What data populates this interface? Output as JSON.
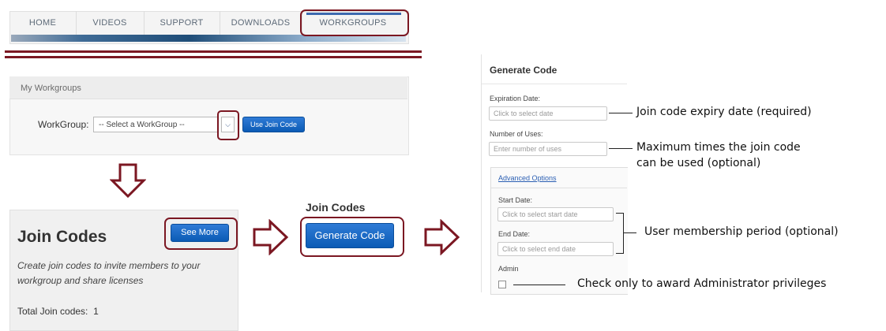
{
  "nav": {
    "items": [
      "HOME",
      "VIDEOS",
      "SUPPORT",
      "DOWNLOADS",
      "WORKGROUPS"
    ]
  },
  "workgroups": {
    "title": "My Workgroups",
    "label": "WorkGroup:",
    "select_value": "-- Select a WorkGroup --",
    "join_button": "Use Join Code"
  },
  "join_codes": {
    "title": "Join Codes",
    "see_more": "See More",
    "description": "Create join codes to invite members to your workgroup and share licenses",
    "total_label": "Total Join codes:",
    "total_value": "1"
  },
  "generate": {
    "heading": "Join Codes",
    "button": "Generate Code"
  },
  "form": {
    "title": "Generate Code",
    "expiration_label": "Expiration Date:",
    "expiration_placeholder": "Click to select date",
    "uses_label": "Number of Uses:",
    "uses_placeholder": "Enter number of uses",
    "advanced_link": "Advanced Options",
    "start_label": "Start Date:",
    "start_placeholder": "Click to select start date",
    "end_label": "End Date:",
    "end_placeholder": "Click to select end date",
    "admin_label": "Admin"
  },
  "annotations": {
    "expiry": "Join code expiry date (required)",
    "max_uses_line1": "Maximum times the join code",
    "max_uses_line2": "can be used (optional)",
    "membership": "User membership period (optional)",
    "admin": "Check only to award Administrator privileges"
  },
  "colors": {
    "highlight": "#7b1722",
    "button_blue": "#0b5bb5",
    "link": "#2b5fb3"
  }
}
